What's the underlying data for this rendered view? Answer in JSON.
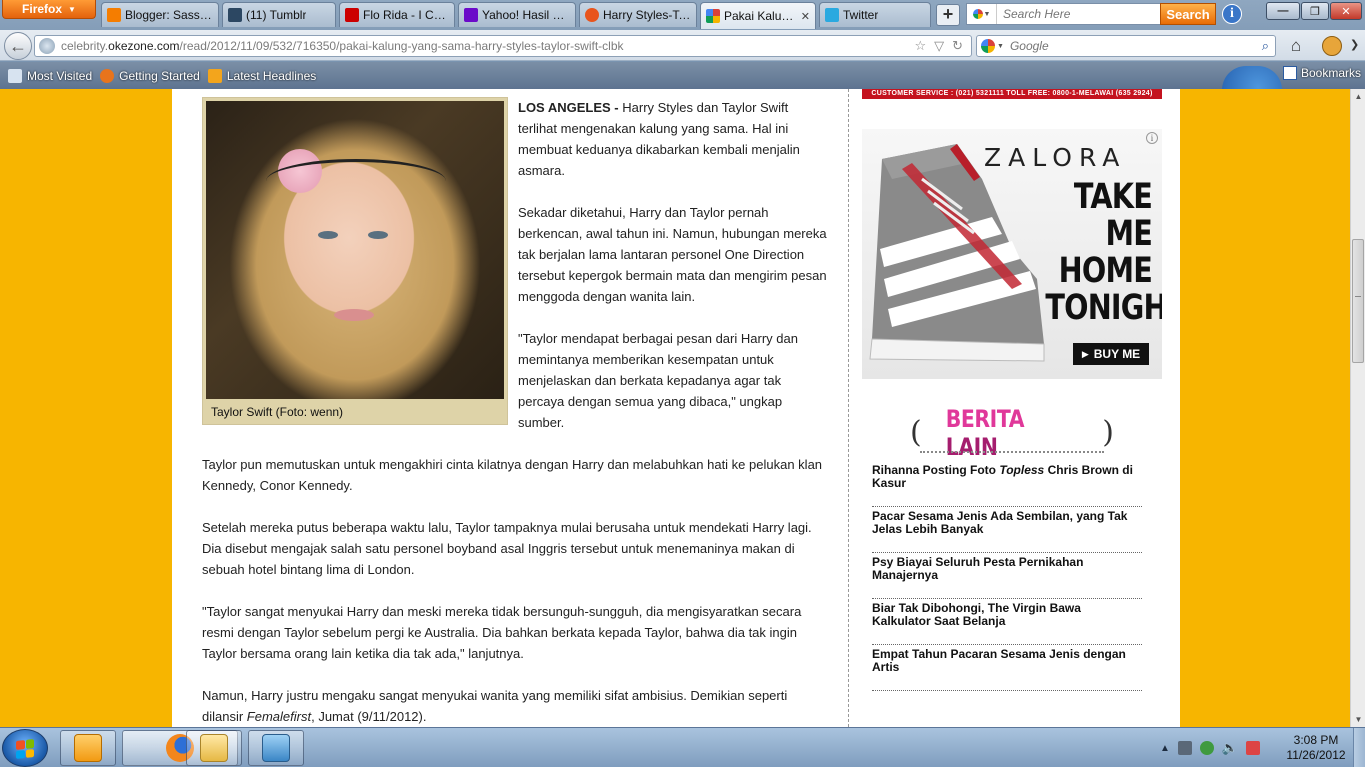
{
  "browser": {
    "menu_label": "Firefox",
    "tabs": [
      {
        "label": "Blogger: Sassy ...",
        "icon_color": "#f57d00",
        "icon": "blogger-icon"
      },
      {
        "label": "(11) Tumblr",
        "icon_color": "#2c4762",
        "icon": "tumblr-icon"
      },
      {
        "label": "Flo Rida - I Cry ...",
        "icon_color": "#cc0000",
        "icon": "youtube-icon"
      },
      {
        "label": "Yahoo! Hasil Ca...",
        "icon_color": "#6b0ac9",
        "icon": "yahoo-icon"
      },
      {
        "label": "Harry Styles-Ta...",
        "icon_color": "#e8541c",
        "icon": "okezone-icon"
      },
      {
        "label": "Pakai Kalung...",
        "icon_color": "#d9413a",
        "icon": "google-icon",
        "active": true
      },
      {
        "label": "Twitter",
        "icon_color": "#2aa9e0",
        "icon": "twitter-icon"
      }
    ],
    "search_placeholder": "Search Here",
    "search_button": "Search",
    "url_prefix": "celebrity.",
    "url_domain": "okezone.com",
    "url_path": "/read/2012/11/09/532/716350/pakai-kalung-yang-sama-harry-styles-taylor-swift-clbk",
    "google_placeholder": "Google",
    "bookmarks": [
      {
        "label": "Most Visited",
        "icon_color": "#d7e3f0"
      },
      {
        "label": "Getting Started",
        "icon_color": "#e8741c"
      },
      {
        "label": "Latest Headlines",
        "icon_color": "#f3a51c"
      }
    ],
    "bookmarks_label": "Bookmarks"
  },
  "article": {
    "photo_caption": "Taylor Swift (Foto: wenn)",
    "dateline": "LOS ANGELES -",
    "p1": " Harry Styles dan Taylor Swift terlihat mengenakan kalung yang sama. Hal ini membuat keduanya dikabarkan kembali menjalin asmara.",
    "p2": "Sekadar diketahui, Harry dan Taylor pernah berkencan, awal tahun ini. Namun, hubungan mereka tak berjalan lama lantaran personel One Direction tersebut kepergok bermain mata dan mengirim pesan menggoda dengan wanita lain.",
    "p3": "\"Taylor mendapat berbagai pesan dari Harry dan memintanya memberikan kesempatan untuk menjelaskan dan berkata kepadanya agar tak percaya dengan semua yang dibaca,\" ungkap sumber.",
    "p4": "Taylor pun memutuskan untuk mengakhiri cinta kilatnya dengan Harry dan melabuhkan hati ke pelukan klan Kennedy, Conor Kennedy.",
    "p5": "Setelah mereka putus beberapa waktu lalu, Taylor tampaknya mulai berusaha untuk mendekati Harry lagi. Dia disebut mengajak salah satu personel boyband asal Inggris tersebut untuk menemaninya makan di sebuah hotel bintang lima di London.",
    "p6": "\"Taylor sangat menyukai Harry dan meski mereka tidak bersunguh-sungguh, dia mengisyaratkan secara resmi dengan Taylor sebelum pergi ke Australia. Dia bahkan berkata kepada Taylor, bahwa dia tak ingin Taylor bersama orang lain ketika dia tak ada,\" lanjutnya.",
    "p7_start": "Namun, Harry justru mengaku sangat menyukai wanita yang memiliki sifat ambisius. Demikian seperti dilansir ",
    "p7_source": "Femalefirst",
    "p7_end": ", Jumat (9/11/2012)."
  },
  "sidebar": {
    "top_strip": "CUSTOMER SERVICE : (021) 5321111    TOLL FREE: 0800-1-MELAWAI (635 2924)",
    "ad": {
      "brand": "ZALORA",
      "tagline_1": "TAKE ME",
      "tagline_2": "HOME",
      "tagline_3": "TONIGHT",
      "cta": "BUY ME",
      "info": "i"
    },
    "berita_word1": "BERITA",
    "berita_word2": "LAIN",
    "items": [
      {
        "pre": "Rihanna Posting Foto ",
        "em": "Topless",
        "post": " Chris Brown di Kasur"
      },
      {
        "pre": "Pacar Sesama Jenis Ada Sembilan, yang Tak Jelas Lebih Banyak",
        "em": "",
        "post": ""
      },
      {
        "pre": "Psy Biayai Seluruh Pesta Pernikahan Manajernya",
        "em": "",
        "post": ""
      },
      {
        "pre": "Biar Tak Dibohongi, The Virgin Bawa Kalkulator Saat Belanja",
        "em": "",
        "post": ""
      },
      {
        "pre": "Empat Tahun Pacaran Sesama Jenis dengan Artis",
        "em": "",
        "post": ""
      }
    ]
  },
  "taskbar": {
    "time": "3:08 PM",
    "date": "11/26/2012"
  }
}
